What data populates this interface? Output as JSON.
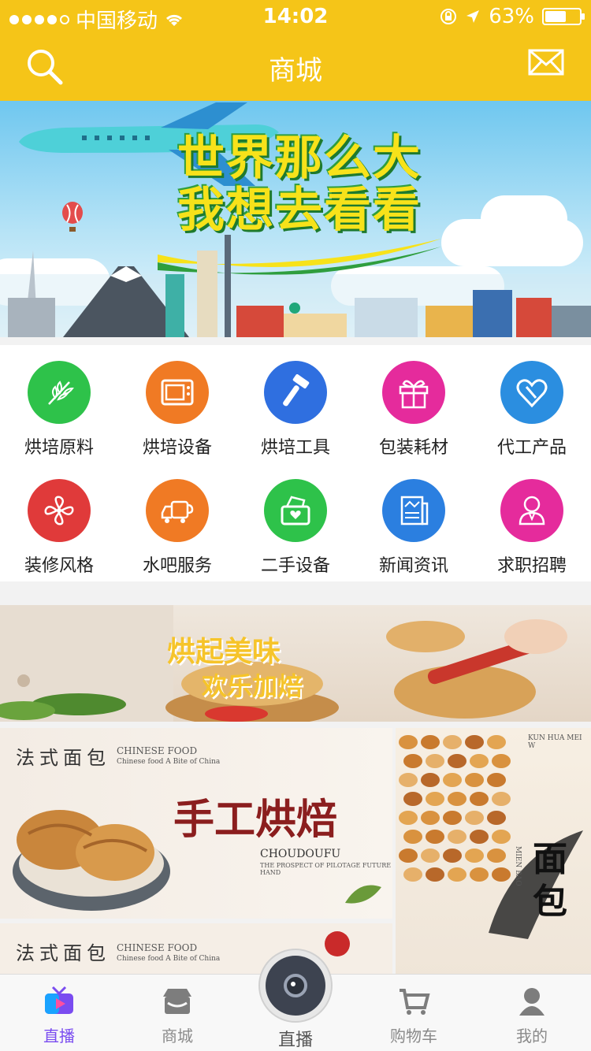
{
  "status_bar": {
    "carrier": "中国移动",
    "time": "14:02",
    "battery": "63%",
    "battery_level": 0.63
  },
  "header": {
    "title": "商城",
    "search_icon": "search-icon",
    "mail_icon": "mail-icon",
    "background_color": "#f5c518"
  },
  "banner": {
    "slogan_line1": "世界那么大",
    "slogan_line2": "我想去看看"
  },
  "categories": [
    {
      "label": "烘培原料",
      "icon": "wheat-icon",
      "color": "#2ec24a"
    },
    {
      "label": "烘培设备",
      "icon": "oven-icon",
      "color": "#f07a24"
    },
    {
      "label": "烘培工具",
      "icon": "tool-icon",
      "color": "#2f6fe0"
    },
    {
      "label": "包装耗材",
      "icon": "gift-icon",
      "color": "#e52b9c"
    },
    {
      "label": "代工产品",
      "icon": "heart-icon",
      "color": "#2b8ee0"
    },
    {
      "label": "装修风格",
      "icon": "fan-icon",
      "color": "#e03a3a"
    },
    {
      "label": "水吧服务",
      "icon": "truck-icon",
      "color": "#f07a24"
    },
    {
      "label": "二手设备",
      "icon": "basket-icon",
      "color": "#2ec24a"
    },
    {
      "label": "新闻资讯",
      "icon": "news-icon",
      "color": "#2b7fe0"
    },
    {
      "label": "求职招聘",
      "icon": "person-icon",
      "color": "#e52b9c"
    }
  ],
  "promo1": {
    "line1": "烘起美味",
    "line2": "欢乐加焙"
  },
  "promo_left": {
    "tag": "法式面包",
    "en1": "CHINESE FOOD",
    "en2": "Chinese food A Bite of China",
    "headline": "手工烘焙",
    "brand": "CHOUDOUFU",
    "brand_sub": "THE PROSPECT OF PILOTAGE FUTURE HAND"
  },
  "promo_left2": {
    "tag": "法式面包",
    "en1": "CHINESE FOOD",
    "en2": "Chinese food A Bite of China"
  },
  "promo_right": {
    "top_en": "KUN HUA MEI W",
    "big_char": "面包",
    "sub_en": "MIEN BAO"
  },
  "tabbar": {
    "tabs": [
      {
        "label": "直播",
        "icon": "tv-icon"
      },
      {
        "label": "商城",
        "icon": "store-icon"
      },
      {
        "label": "购物车",
        "icon": "cart-icon"
      },
      {
        "label": "我的",
        "icon": "profile-icon"
      }
    ],
    "center_label": "直播",
    "center_icon": "camera-icon",
    "active_color": "#7a4cf0"
  }
}
